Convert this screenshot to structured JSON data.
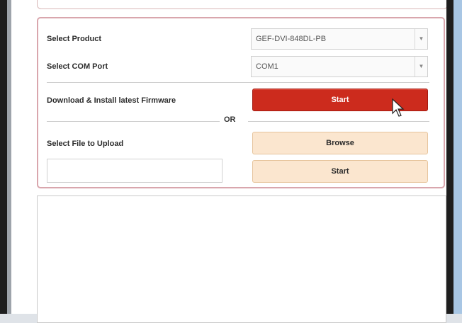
{
  "form": {
    "product_label": "Select Product",
    "product_value": "GEF-DVI-848DL-PB",
    "port_label": "Select COM Port",
    "port_value": "COM1",
    "download_label": "Download & Install latest Firmware",
    "start_label": "Start",
    "or_label": "OR",
    "upload_label": "Select File to Upload",
    "browse_label": "Browse",
    "upload_start_label": "Start",
    "file_path": ""
  },
  "colors": {
    "primary_button": "#cc2b1d",
    "secondary_button": "#fbe6cf",
    "panel_border": "#d9a6ad"
  },
  "icons": {
    "dropdown": "chevron-down-icon",
    "cursor": "mouse-pointer-icon"
  }
}
